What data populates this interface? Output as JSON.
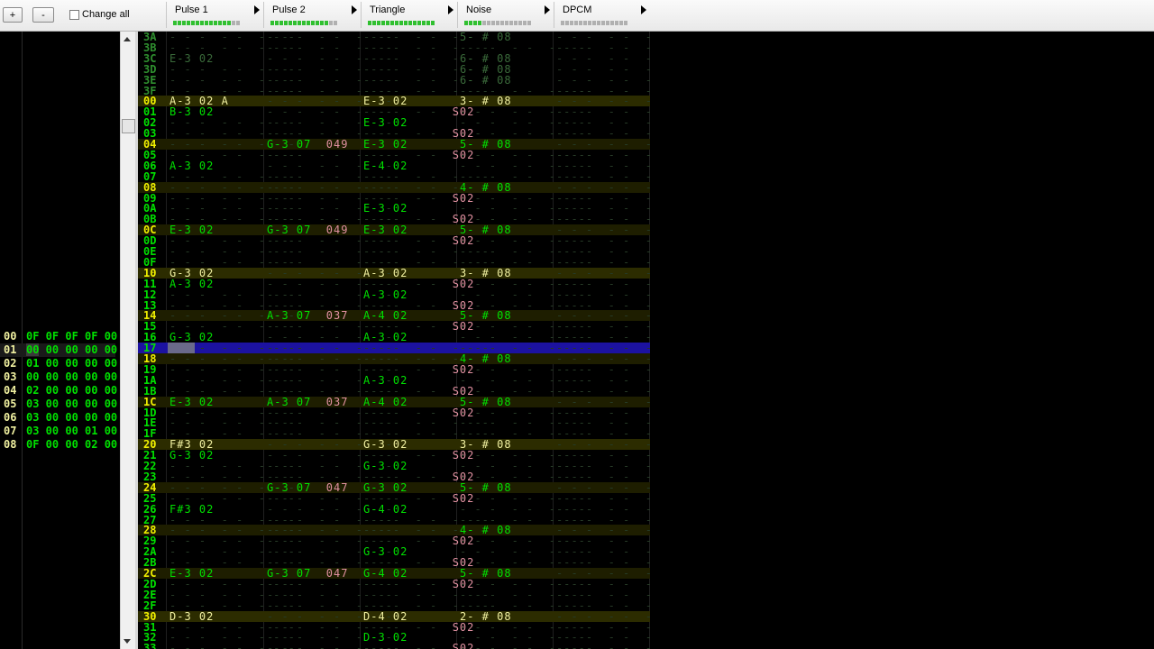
{
  "toolbar": {
    "add_label": "+",
    "remove_label": "-",
    "change_all_label": "Change all",
    "channels": [
      {
        "name": "Pulse 1",
        "vu_level": 13
      },
      {
        "name": "Pulse 2",
        "vu_level": 13
      },
      {
        "name": "Triangle",
        "vu_level": 15
      },
      {
        "name": "Noise",
        "vu_level": 4
      },
      {
        "name": "DPCM",
        "vu_level": 0
      }
    ]
  },
  "frames": [
    {
      "index": "00",
      "cells": "0F 0F 0F 0F 00"
    },
    {
      "index": "01",
      "cells": "00 00 00 00 00"
    },
    {
      "index": "02",
      "cells": "01 00 00 00 00"
    },
    {
      "index": "03",
      "cells": "00 00 00 00 00"
    },
    {
      "index": "04",
      "cells": "02 00 00 00 00"
    },
    {
      "index": "05",
      "cells": "03 00 00 00 00"
    },
    {
      "index": "06",
      "cells": "03 00 00 00 00"
    },
    {
      "index": "07",
      "cells": "03 00 00 01 00"
    },
    {
      "index": "08",
      "cells": "0F 00 00 02 00"
    }
  ],
  "current_frame": 1,
  "pattern_rows": [
    {
      "idx": "3A",
      "p1": "",
      "p2": "",
      "tri": "",
      "noise": "5- # 08",
      "prev": true
    },
    {
      "idx": "3B",
      "p1": "",
      "p2": "",
      "tri": "",
      "noise": "",
      "prev": true
    },
    {
      "idx": "3C",
      "p1": "E-3 02",
      "p2": "",
      "tri": "",
      "noise": "6- # 08",
      "prev": true
    },
    {
      "idx": "3D",
      "p1": "",
      "p2": "",
      "tri": "",
      "noise": "6- # 08",
      "prev": true
    },
    {
      "idx": "3E",
      "p1": "",
      "p2": "",
      "tri": "",
      "noise": "6- # 08",
      "prev": true
    },
    {
      "idx": "3F",
      "p1": "",
      "p2": "",
      "tri": "",
      "noise": "",
      "prev": true
    },
    {
      "idx": "00",
      "p1": "A-3 02 A",
      "p2": "",
      "tri": "E-3 02",
      "noise": "3- # 08"
    },
    {
      "idx": "01",
      "p1": "B-3 02",
      "p2": "",
      "tri": "S02",
      "noise": ""
    },
    {
      "idx": "02",
      "p1": "",
      "p2": "",
      "tri": "E-3 02",
      "noise": ""
    },
    {
      "idx": "03",
      "p1": "",
      "p2": "",
      "tri": "S02",
      "noise": ""
    },
    {
      "idx": "04",
      "p1": "",
      "p2": "G-3 07 049",
      "tri": "E-3 02",
      "noise": "5- # 08"
    },
    {
      "idx": "05",
      "p1": "",
      "p2": "",
      "tri": "S02",
      "noise": ""
    },
    {
      "idx": "06",
      "p1": "A-3 02",
      "p2": "",
      "tri": "E-4 02",
      "noise": ""
    },
    {
      "idx": "07",
      "p1": "",
      "p2": "",
      "tri": "",
      "noise": ""
    },
    {
      "idx": "08",
      "p1": "",
      "p2": "",
      "tri": "",
      "noise": "4- # 08"
    },
    {
      "idx": "09",
      "p1": "",
      "p2": "",
      "tri": "S02",
      "noise": ""
    },
    {
      "idx": "0A",
      "p1": "",
      "p2": "",
      "tri": "E-3 02",
      "noise": ""
    },
    {
      "idx": "0B",
      "p1": "",
      "p2": "",
      "tri": "S02",
      "noise": ""
    },
    {
      "idx": "0C",
      "p1": "E-3 02",
      "p2": "G-3 07 049",
      "tri": "E-3 02",
      "noise": "5- # 08"
    },
    {
      "idx": "0D",
      "p1": "",
      "p2": "",
      "tri": "S02",
      "noise": ""
    },
    {
      "idx": "0E",
      "p1": "",
      "p2": "",
      "tri": "",
      "noise": ""
    },
    {
      "idx": "0F",
      "p1": "",
      "p2": "",
      "tri": "",
      "noise": ""
    },
    {
      "idx": "10",
      "p1": "G-3 02",
      "p2": "",
      "tri": "A-3 02",
      "noise": "3- # 08"
    },
    {
      "idx": "11",
      "p1": "A-3 02",
      "p2": "",
      "tri": "S02",
      "noise": ""
    },
    {
      "idx": "12",
      "p1": "",
      "p2": "",
      "tri": "A-3 02",
      "noise": ""
    },
    {
      "idx": "13",
      "p1": "",
      "p2": "",
      "tri": "S02",
      "noise": ""
    },
    {
      "idx": "14",
      "p1": "",
      "p2": "A-3 07 037",
      "tri": "A-4 02",
      "noise": "5- # 08"
    },
    {
      "idx": "15",
      "p1": "",
      "p2": "",
      "tri": "S02",
      "noise": ""
    },
    {
      "idx": "16",
      "p1": "G-3 02",
      "p2": "",
      "tri": "A-3 02",
      "noise": ""
    },
    {
      "idx": "17",
      "p1": "",
      "p2": "",
      "tri": "",
      "noise": "",
      "cursor": true
    },
    {
      "idx": "18",
      "p1": "",
      "p2": "",
      "tri": "",
      "noise": "4- # 08"
    },
    {
      "idx": "19",
      "p1": "",
      "p2": "",
      "tri": "S02",
      "noise": ""
    },
    {
      "idx": "1A",
      "p1": "",
      "p2": "",
      "tri": "A-3 02",
      "noise": ""
    },
    {
      "idx": "1B",
      "p1": "",
      "p2": "",
      "tri": "S02",
      "noise": ""
    },
    {
      "idx": "1C",
      "p1": "E-3 02",
      "p2": "A-3 07 037",
      "tri": "A-4 02",
      "noise": "5- # 08"
    },
    {
      "idx": "1D",
      "p1": "",
      "p2": "",
      "tri": "S02",
      "noise": ""
    },
    {
      "idx": "1E",
      "p1": "",
      "p2": "",
      "tri": "",
      "noise": ""
    },
    {
      "idx": "1F",
      "p1": "",
      "p2": "",
      "tri": "",
      "noise": ""
    },
    {
      "idx": "20",
      "p1": "F#3 02",
      "p2": "",
      "tri": "G-3 02",
      "noise": "3- # 08"
    },
    {
      "idx": "21",
      "p1": "G-3 02",
      "p2": "",
      "tri": "S02",
      "noise": ""
    },
    {
      "idx": "22",
      "p1": "",
      "p2": "",
      "tri": "G-3 02",
      "noise": ""
    },
    {
      "idx": "23",
      "p1": "",
      "p2": "",
      "tri": "S02",
      "noise": ""
    },
    {
      "idx": "24",
      "p1": "",
      "p2": "G-3 07 047",
      "tri": "G-3 02",
      "noise": "5- # 08"
    },
    {
      "idx": "25",
      "p1": "",
      "p2": "",
      "tri": "S02",
      "noise": ""
    },
    {
      "idx": "26",
      "p1": "F#3 02",
      "p2": "",
      "tri": "G-4 02",
      "noise": ""
    },
    {
      "idx": "27",
      "p1": "",
      "p2": "",
      "tri": "",
      "noise": ""
    },
    {
      "idx": "28",
      "p1": "",
      "p2": "",
      "tri": "",
      "noise": "4- # 08"
    },
    {
      "idx": "29",
      "p1": "",
      "p2": "",
      "tri": "S02",
      "noise": ""
    },
    {
      "idx": "2A",
      "p1": "",
      "p2": "",
      "tri": "G-3 02",
      "noise": ""
    },
    {
      "idx": "2B",
      "p1": "",
      "p2": "",
      "tri": "S02",
      "noise": ""
    },
    {
      "idx": "2C",
      "p1": "E-3 02",
      "p2": "G-3 07 047",
      "tri": "G-4 02",
      "noise": "5- # 08"
    },
    {
      "idx": "2D",
      "p1": "",
      "p2": "",
      "tri": "S02",
      "noise": ""
    },
    {
      "idx": "2E",
      "p1": "",
      "p2": "",
      "tri": "",
      "noise": ""
    },
    {
      "idx": "2F",
      "p1": "",
      "p2": "",
      "tri": "",
      "noise": ""
    },
    {
      "idx": "30",
      "p1": "D-3 02",
      "p2": "",
      "tri": "D-4 02",
      "noise": "2- # 08"
    },
    {
      "idx": "31",
      "p1": "",
      "p2": "",
      "tri": "S02",
      "noise": ""
    },
    {
      "idx": "32",
      "p1": "",
      "p2": "",
      "tri": "D-3 02",
      "noise": ""
    },
    {
      "idx": "33",
      "p1": "",
      "p2": "",
      "tri": "S02",
      "noise": ""
    }
  ]
}
